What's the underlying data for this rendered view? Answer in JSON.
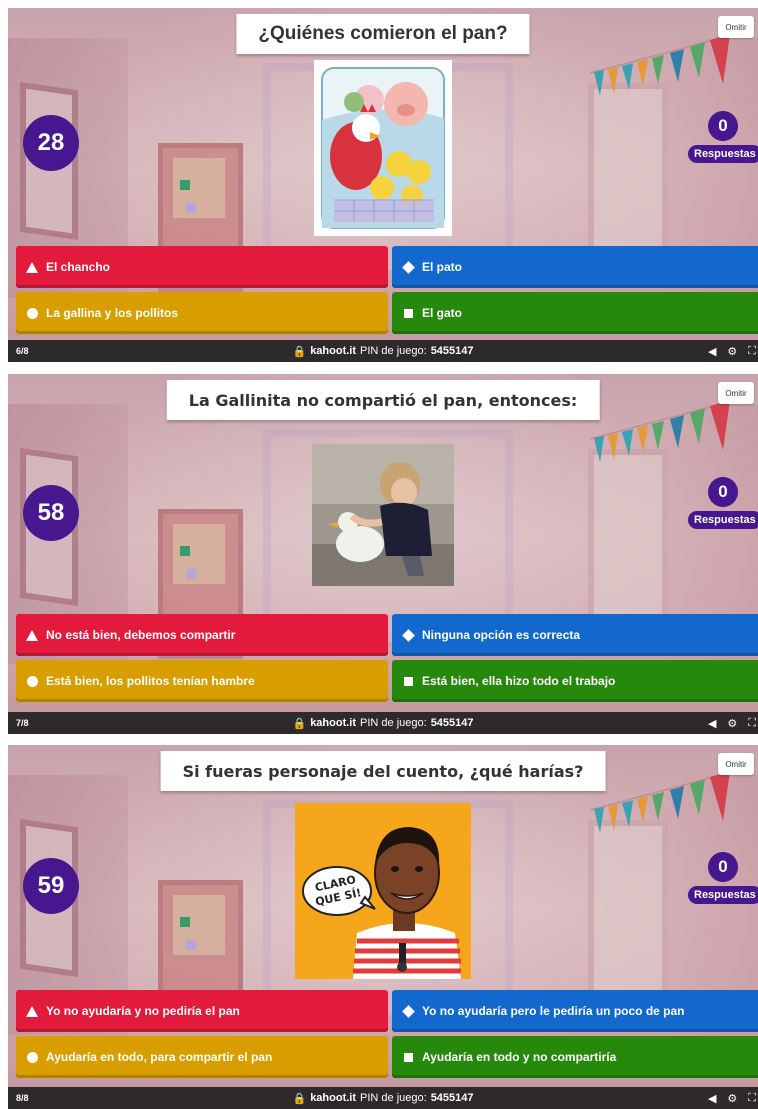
{
  "colors": {
    "red": "#e21b3c",
    "blue": "#1368ce",
    "yellow": "#d89e00",
    "green": "#26890c",
    "purple": "#46178f",
    "bar": "#2e2a2c"
  },
  "common": {
    "skip_label": "Omitir",
    "answers_label": "Respuestas",
    "lock_icon": "lock-icon",
    "site": "kahoot.it",
    "pin_label": "PIN de juego:",
    "pin": "5455147",
    "volume_icon": "volume-icon",
    "settings_icon": "gear-icon",
    "fullscreen_icon": "fullscreen-icon"
  },
  "screens": [
    {
      "question": "¿Quiénes comieron el pan?",
      "timer": "28",
      "answer_count": "0",
      "image": "illustration of a hen, chicks, pig, cat and duck eating bread",
      "answers": [
        {
          "shape": "triangle",
          "label": "El chancho"
        },
        {
          "shape": "diamond",
          "label": "El pato"
        },
        {
          "shape": "circle",
          "label": "La gallina y los pollitos"
        },
        {
          "shape": "square",
          "label": "El gato"
        }
      ],
      "progress": "6/8"
    },
    {
      "question": "La Gallinita no compartió el pan, entonces:",
      "timer": "58",
      "answer_count": "0",
      "image": "photo of a child hugging a white duck",
      "answers": [
        {
          "shape": "triangle",
          "label": "No está bien, debemos compartir"
        },
        {
          "shape": "diamond",
          "label": "Ninguna opción es correcta"
        },
        {
          "shape": "circle",
          "label": "Está bien, los pollitos tenían hambre"
        },
        {
          "shape": "square",
          "label": "Está bien, ella hizo todo el trabajo"
        }
      ],
      "progress": "7/8"
    },
    {
      "question": "Si fueras personaje del cuento, ¿qué harías?",
      "timer": "59",
      "answer_count": "0",
      "image_text": "CLARO QUE SÍ!",
      "answers": [
        {
          "shape": "triangle",
          "label": "Yo no ayudaría y no pediría el pan"
        },
        {
          "shape": "diamond",
          "label": "Yo no ayudaría pero le pediría un poco de pan"
        },
        {
          "shape": "circle",
          "label": "Ayudaría en todo, para compartir el pan"
        },
        {
          "shape": "square",
          "label": "Ayudaría en todo y no compartiría"
        }
      ],
      "progress": "8/8"
    }
  ]
}
